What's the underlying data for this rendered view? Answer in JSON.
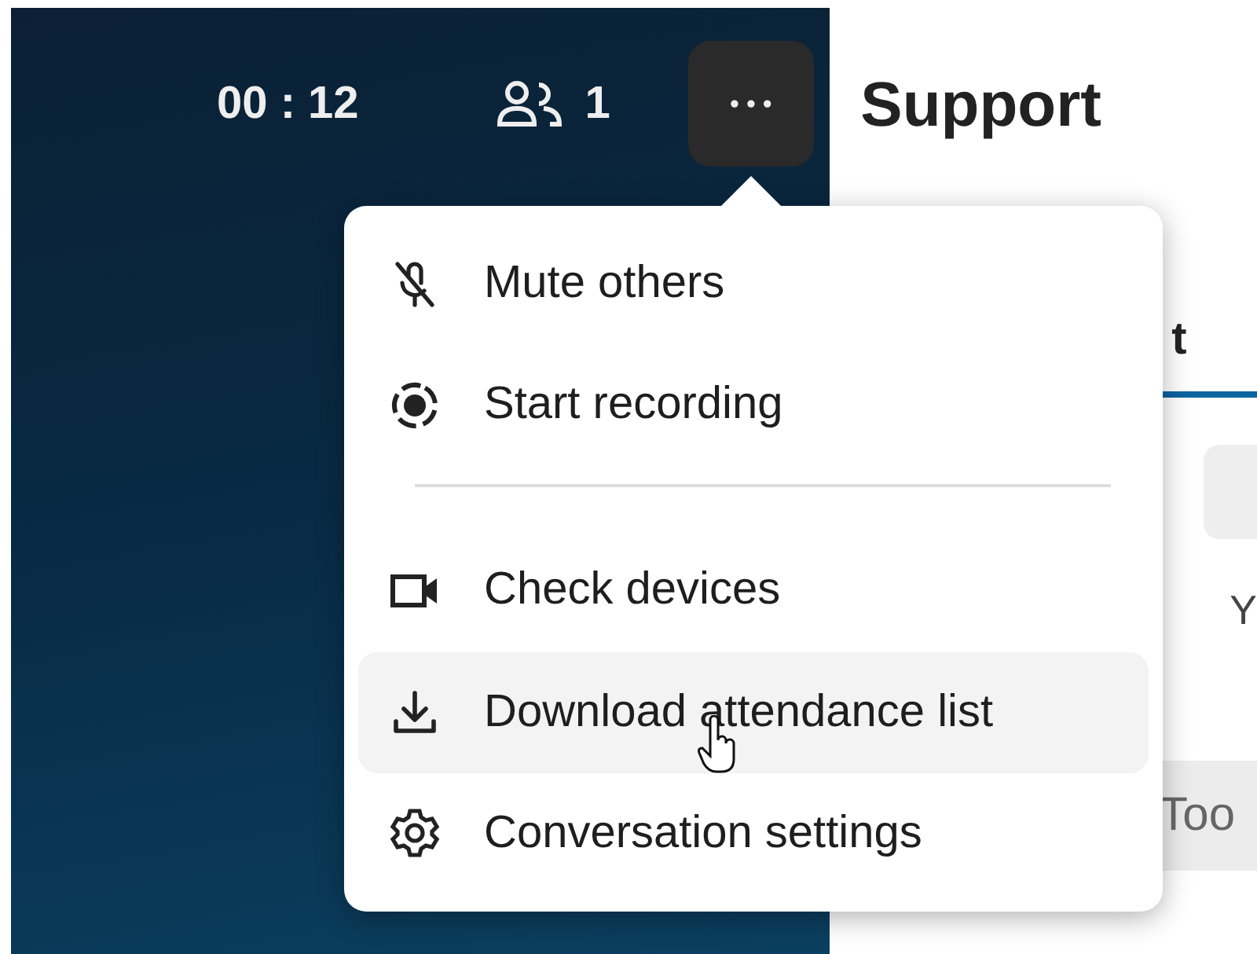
{
  "call_bar": {
    "timer": "00 : 12",
    "participants": "1",
    "more_button": {
      "label": "•••"
    }
  },
  "panel": {
    "title": "Support",
    "tab_fragment": "t",
    "tab_selected": true,
    "body_fragment": "Y",
    "footer_fragment": "Too"
  },
  "menu": {
    "items": [
      {
        "kind": "mute",
        "label": "Mute others",
        "hovered": false
      },
      {
        "kind": "record",
        "label": "Start recording",
        "hovered": false
      },
      {
        "kind": "divider"
      },
      {
        "kind": "devices",
        "label": "Check devices",
        "hovered": false
      },
      {
        "kind": "download",
        "label": "Download attendance list",
        "hovered": true
      },
      {
        "kind": "settings",
        "label": "Conversation settings",
        "hovered": false
      }
    ]
  }
}
